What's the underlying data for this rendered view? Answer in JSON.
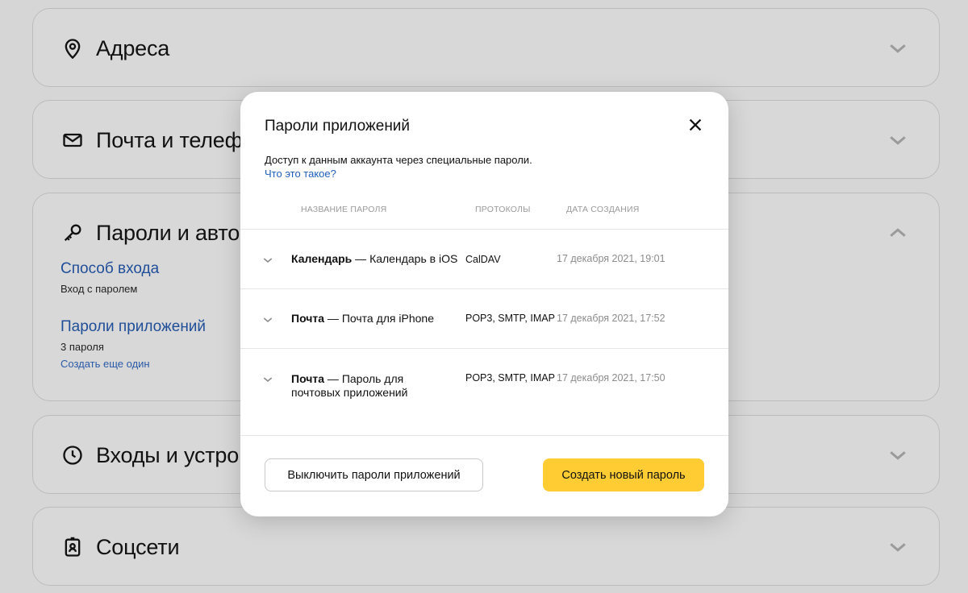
{
  "sections": {
    "addresses": {
      "title": "Адреса",
      "icon": "location-pin-icon"
    },
    "mail_phone": {
      "title": "Почта и телеф",
      "icon": "envelope-icon"
    },
    "passwords": {
      "title": "Пароли и авто",
      "icon": "key-icon",
      "login_method_link": "Способ входа",
      "login_method_value": "Вход с паролем",
      "app_passwords_link": "Пароли приложений",
      "app_passwords_count": "3 пароля",
      "create_another_link": "Создать еще один"
    },
    "logins_devices": {
      "title": "Входы и устро",
      "icon": "clock-icon"
    },
    "social": {
      "title": "Соцсети",
      "icon": "id-badge-icon"
    }
  },
  "modal": {
    "title": "Пароли приложений",
    "description": "Доступ к данным аккаунта через специальные пароли.",
    "help_link": "Что это такое?",
    "columns": {
      "name": "НАЗВАНИЕ ПАРОЛЯ",
      "protocols": "ПРОТОКОЛЫ",
      "created": "ДАТА СОЗДАНИЯ"
    },
    "rows": [
      {
        "name_bold": "Календарь",
        "name_rest": " — Календарь в iOS",
        "protocols": "CalDAV",
        "created": "17 декабря 2021, 19:01"
      },
      {
        "name_bold": "Почта",
        "name_rest": " — Почта для iPhone",
        "protocols": "POP3, SMTP, IMAP",
        "created": "17 декабря 2021, 17:52"
      },
      {
        "name_bold": "Почта",
        "name_rest": " — Пароль для почтовых приложений",
        "protocols": "POP3, SMTP, IMAP",
        "created": "17 декабря 2021, 17:50"
      }
    ],
    "disable_button": "Выключить пароли приложений",
    "create_button": "Создать новый пароль"
  },
  "colors": {
    "background": "#d6d6d6",
    "link": "#1f4e99",
    "accent_button": "#ffcc33",
    "muted_text": "#8c8c8c"
  }
}
